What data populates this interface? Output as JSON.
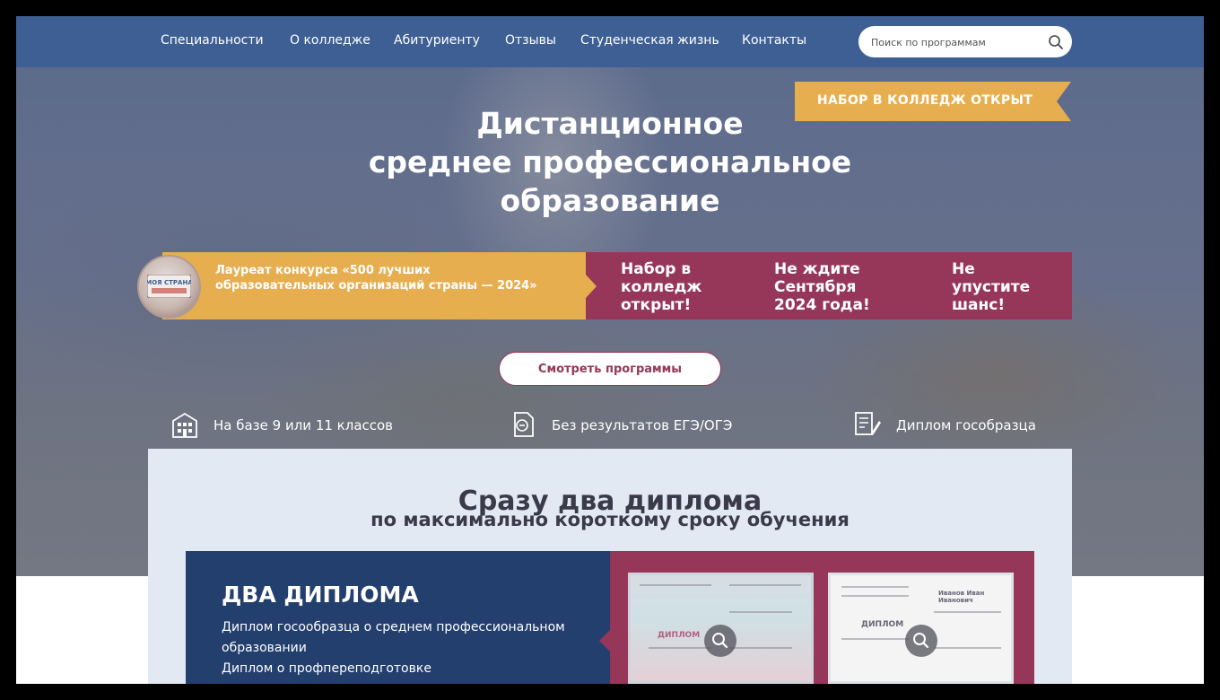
{
  "nav": {
    "items": [
      "Специальности",
      "О колледже",
      "Абитуриенту",
      "Отзывы",
      "Студенческая жизнь",
      "Контакты"
    ],
    "search_placeholder": "Поиск по программам"
  },
  "hero": {
    "ribbon": "НАБОР В КОЛЛЕДЖ ОТКРЫТ",
    "title_lines": [
      "Дистанционное",
      "среднее профессиональное",
      "образование"
    ],
    "laureate_lines": [
      "Лауреат конкурса «500 лучших",
      "образовательных организаций страны — 2024»"
    ],
    "medal_text": "МОЯ СТРАНА",
    "promo": [
      [
        "Набор в",
        "колледж",
        "открыт!"
      ],
      [
        "Не ждите",
        "Сентября",
        "2024 года!"
      ],
      [
        "Не",
        "упустите",
        "шанс!"
      ]
    ],
    "cta": "Смотреть программы",
    "features": [
      "На базе 9 или 11 классов",
      "Без результатов ЕГЭ/ОГЭ",
      "Диплом гособразца"
    ]
  },
  "diplomas": {
    "heading": "Сразу два диплома",
    "subheading": "по максимально короткому сроку обучения",
    "card_title": "ДВА ДИПЛОМА",
    "card_lines": [
      "Диплом госообразца о среднем профессиональном",
      "образовании",
      "Диплом о профпереподготовке"
    ],
    "doc1_title": "ДИПЛОМ",
    "doc2_name": "Иванов Иван Иванович",
    "doc2_title": "ДИПЛОМ"
  },
  "colors": {
    "nav": "#3e5f94",
    "gold": "#e6ae4e",
    "burgundy": "#963759",
    "navy": "#233f6e",
    "panel": "#e3e9f2"
  }
}
